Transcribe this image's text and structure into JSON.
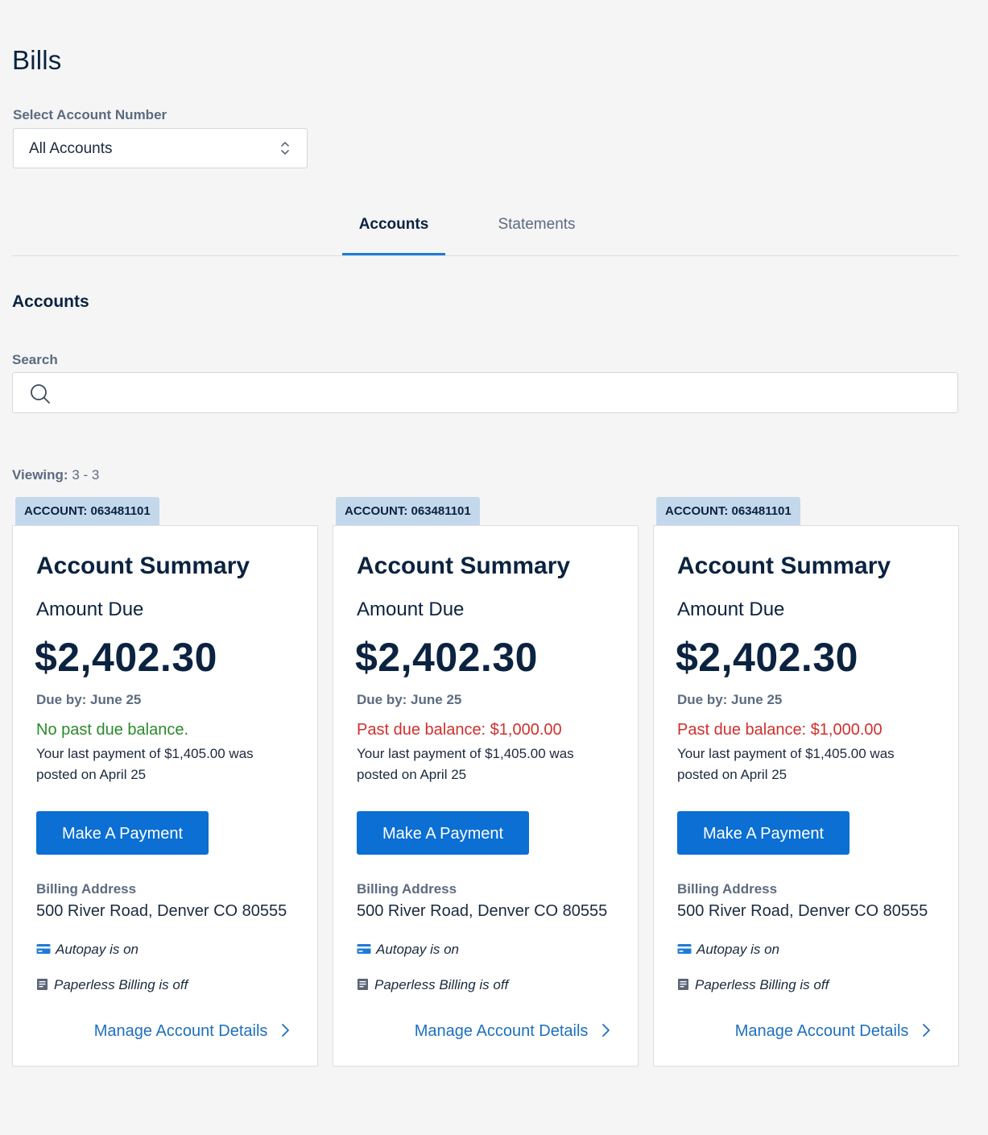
{
  "page": {
    "title": "Bills"
  },
  "account_select": {
    "label": "Select Account Number",
    "value": "All Accounts"
  },
  "tabs": [
    {
      "label": "Accounts",
      "active": true
    },
    {
      "label": "Statements",
      "active": false
    }
  ],
  "section": {
    "heading": "Accounts",
    "search_label": "Search",
    "search_value": "",
    "viewing_label": "Viewing:",
    "viewing_range": "3 - 3"
  },
  "colors": {
    "primary": "#0b6fd3",
    "tab_accent": "#1e7bd6",
    "ok": "#2a8a2a",
    "bad": "#d0302c",
    "tag_bg": "#c4d8ec"
  },
  "cards": [
    {
      "account_tag": "ACCOUNT:  063481101",
      "title": "Account Summary",
      "amount_label": "Amount Due",
      "amount": "$2,402.30",
      "due_by": "Due by: June 25",
      "past_due_text": "No past due balance.",
      "past_due_status": "ok",
      "last_payment": "Your last payment of $1,405.00 was posted on April 25",
      "pay_button": "Make A Payment",
      "billing_label": "Billing Address",
      "billing_address": "500 River Road, Denver CO 80555",
      "autopay": "Autopay is on",
      "paperless": "Paperless Billing is off",
      "manage_link": "Manage Account Details"
    },
    {
      "account_tag": "ACCOUNT:  063481101",
      "title": "Account Summary",
      "amount_label": "Amount Due",
      "amount": "$2,402.30",
      "due_by": "Due by: June 25",
      "past_due_text": "Past due balance: $1,000.00",
      "past_due_status": "bad",
      "last_payment": "Your last payment of $1,405.00 was posted on April 25",
      "pay_button": "Make A Payment",
      "billing_label": "Billing Address",
      "billing_address": "500 River Road, Denver CO 80555",
      "autopay": "Autopay is on",
      "paperless": "Paperless Billing is off",
      "manage_link": "Manage Account Details"
    },
    {
      "account_tag": "ACCOUNT:  063481101",
      "title": "Account Summary",
      "amount_label": "Amount Due",
      "amount": "$2,402.30",
      "due_by": "Due by: June 25",
      "past_due_text": "Past due balance: $1,000.00",
      "past_due_status": "bad",
      "last_payment": "Your last payment of $1,405.00 was posted on April 25",
      "pay_button": "Make A Payment",
      "billing_label": "Billing Address",
      "billing_address": "500 River Road, Denver CO 80555",
      "autopay": "Autopay is on",
      "paperless": "Paperless Billing is off",
      "manage_link": "Manage Account Details"
    }
  ]
}
